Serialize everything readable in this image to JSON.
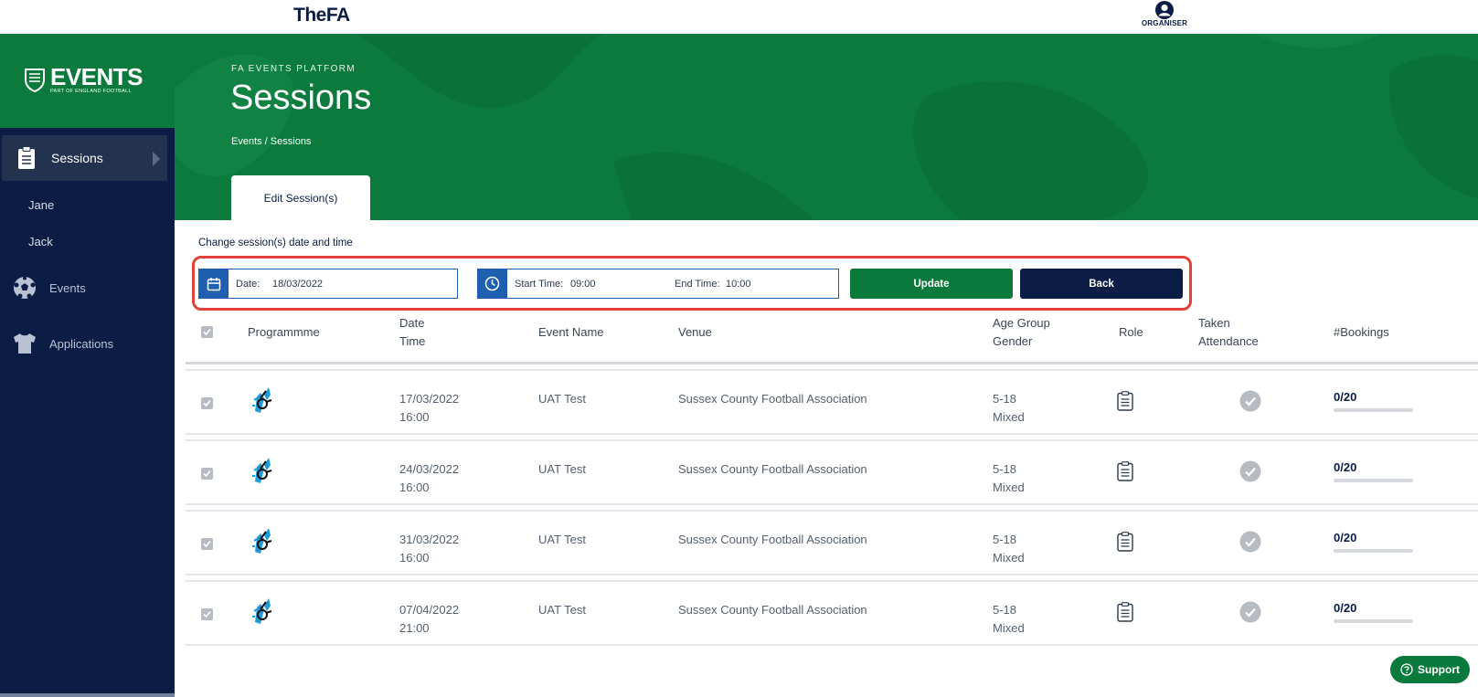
{
  "brand": {
    "fa_logo": "TheFA",
    "events_logo": "EVENTS",
    "events_sub": "PART OF ENGLAND FOOTBALL"
  },
  "user": {
    "role": "ORGANISER"
  },
  "sidebar": {
    "items": [
      {
        "label": "Sessions",
        "icon": "clipboard-icon"
      },
      {
        "label": "Jane"
      },
      {
        "label": "Jack"
      },
      {
        "label": "Events",
        "icon": "football-icon"
      },
      {
        "label": "Applications",
        "icon": "shirt-icon"
      }
    ]
  },
  "hero": {
    "kicker": "FA EVENTS PLATFORM",
    "title": "Sessions",
    "breadcrumb": "Events / Sessions",
    "tab": "Edit Session(s)"
  },
  "form": {
    "section_label": "Change session(s) date and time",
    "date_label": "Date:",
    "date_value": "18/03/2022",
    "start_label": "Start Time:",
    "start_value": "09:00",
    "end_label": "End Time:",
    "end_value": "10:00",
    "update_label": "Update",
    "back_label": "Back"
  },
  "table": {
    "headers": {
      "programme": "Programmme",
      "date": "Date",
      "time": "Time",
      "event_name": "Event Name",
      "venue": "Venue",
      "age_group": "Age Group",
      "gender": "Gender",
      "role": "Role",
      "taken": "Taken",
      "attendance": "Attendance",
      "bookings": "#Bookings"
    },
    "rows": [
      {
        "date": "17/03/2022",
        "time": "16:00",
        "event": "UAT Test",
        "venue": "Sussex County Football Association",
        "age": "5-18",
        "gender": "Mixed",
        "bookings": "0/20"
      },
      {
        "date": "24/03/2022",
        "time": "16:00",
        "event": "UAT Test",
        "venue": "Sussex County Football Association",
        "age": "5-18",
        "gender": "Mixed",
        "bookings": "0/20"
      },
      {
        "date": "31/03/2022",
        "time": "16:00",
        "event": "UAT Test",
        "venue": "Sussex County Football Association",
        "age": "5-18",
        "gender": "Mixed",
        "bookings": "0/20"
      },
      {
        "date": "07/04/2022",
        "time": "21:00",
        "event": "UAT Test",
        "venue": "Sussex County Football Association",
        "age": "5-18",
        "gender": "Mixed",
        "bookings": "0/20"
      }
    ]
  },
  "support": {
    "label": "Support"
  },
  "colors": {
    "brand_green": "#0c7a3d",
    "navy": "#0b1d44",
    "field_blue": "#1f5fb0",
    "highlight_red": "#e0423a"
  }
}
